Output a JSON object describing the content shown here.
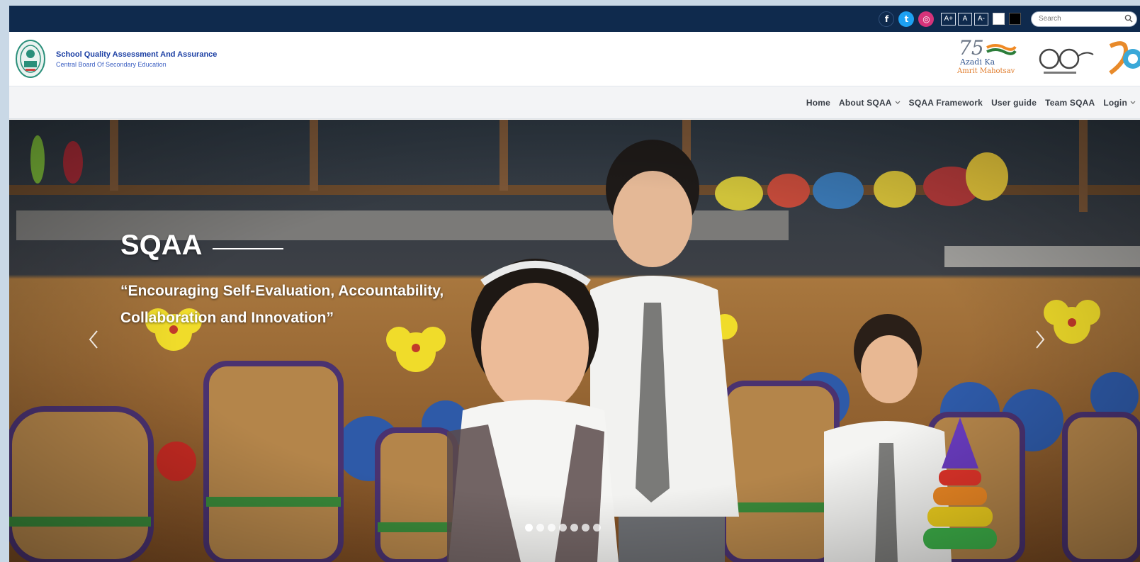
{
  "topbar": {
    "social": [
      {
        "name": "facebook-icon",
        "glyph": "f"
      },
      {
        "name": "twitter-icon",
        "glyph": "t"
      },
      {
        "name": "instagram-icon",
        "glyph": "◎"
      }
    ],
    "font_buttons": [
      "A+",
      "A",
      "A-"
    ],
    "search": {
      "placeholder": "Search"
    }
  },
  "header": {
    "title": "School Quality Assessment And Assurance",
    "subtitle": "Central Board Of Secondary Education",
    "azadi": {
      "seventy": "75",
      "line1": "Azadi Ka",
      "line2": "Amrit Mahotsav"
    }
  },
  "nav": {
    "items": [
      {
        "label": "Home",
        "dropdown": false
      },
      {
        "label": "About SQAA",
        "dropdown": true
      },
      {
        "label": "SQAA Framework",
        "dropdown": false
      },
      {
        "label": "User guide",
        "dropdown": false
      },
      {
        "label": "Team SQAA",
        "dropdown": false
      },
      {
        "label": "Login",
        "dropdown": true
      }
    ]
  },
  "hero": {
    "title": "SQAA",
    "quote": "“Encouraging Self-Evaluation, Accountability, Collaboration and Innovation”",
    "slide_count": 7,
    "active_slide": 0
  },
  "colors": {
    "topbar": "#0f2a4d",
    "title": "#1a3ea3",
    "nav_text": "#3a3f47"
  }
}
